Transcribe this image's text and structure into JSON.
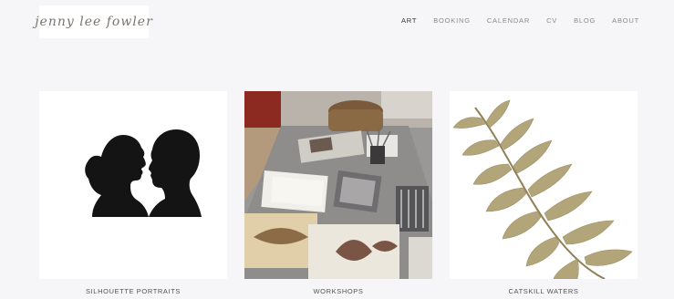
{
  "site": {
    "logo_text": "jenny lee fowler"
  },
  "nav": {
    "items": [
      {
        "label": "ART",
        "active": true
      },
      {
        "label": "BOOKING",
        "active": false
      },
      {
        "label": "CALENDAR",
        "active": false
      },
      {
        "label": "CV",
        "active": false
      },
      {
        "label": "BLOG",
        "active": false
      },
      {
        "label": "ABOUT",
        "active": false
      }
    ]
  },
  "gallery": {
    "items": [
      {
        "caption": "SILHOUETTE PORTRAITS"
      },
      {
        "caption": "WORKSHOPS"
      },
      {
        "caption": "CATSKILL WATERS"
      }
    ]
  },
  "colors": {
    "background": "#f6f5f7",
    "text": "#555555",
    "nav_active": "#333333"
  }
}
